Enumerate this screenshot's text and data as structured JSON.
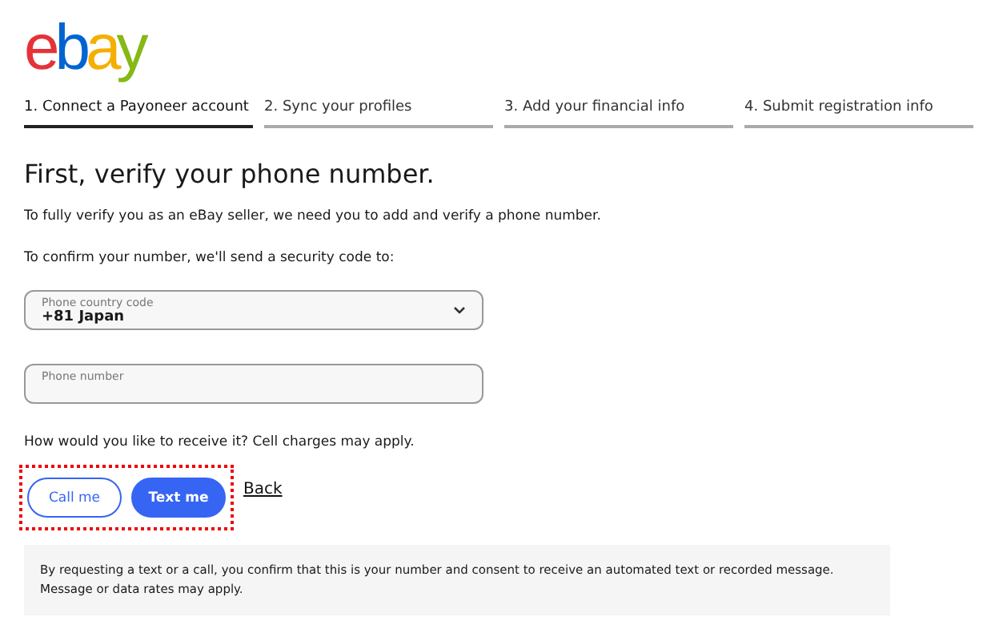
{
  "logo": {
    "letters": [
      {
        "char": "e",
        "color": "#e53238"
      },
      {
        "char": "b",
        "color": "#0064d2"
      },
      {
        "char": "a",
        "color": "#f5af02"
      },
      {
        "char": "y",
        "color": "#86b817"
      }
    ]
  },
  "steps": [
    {
      "label": "1. Connect a Payoneer account",
      "selected": true
    },
    {
      "label": "2. Sync your profiles",
      "selected": false
    },
    {
      "label": "3. Add your financial info",
      "selected": false
    },
    {
      "label": "4. Submit registration info",
      "selected": false
    }
  ],
  "heading": "First, verify your phone number.",
  "intro": "To fully verify you as an eBay seller, we need you to add and verify a phone number.",
  "confirm_text": "To confirm your number, we'll send a security code to:",
  "country_select": {
    "label": "Phone country code",
    "value": "+81 Japan"
  },
  "phone_field": {
    "placeholder": "Phone number"
  },
  "receive_prompt": "How would you like to receive it? Cell charges may apply.",
  "actions": {
    "highlighted": true,
    "buttons": [
      {
        "label": "Call me",
        "kind": "secondary"
      },
      {
        "label": "Text me",
        "kind": "primary"
      }
    ]
  },
  "back_link": "Back",
  "notice": "By requesting a text or a call, you confirm that this is your number and consent to receive an automated text or recorded message. Message or data rates may apply."
}
